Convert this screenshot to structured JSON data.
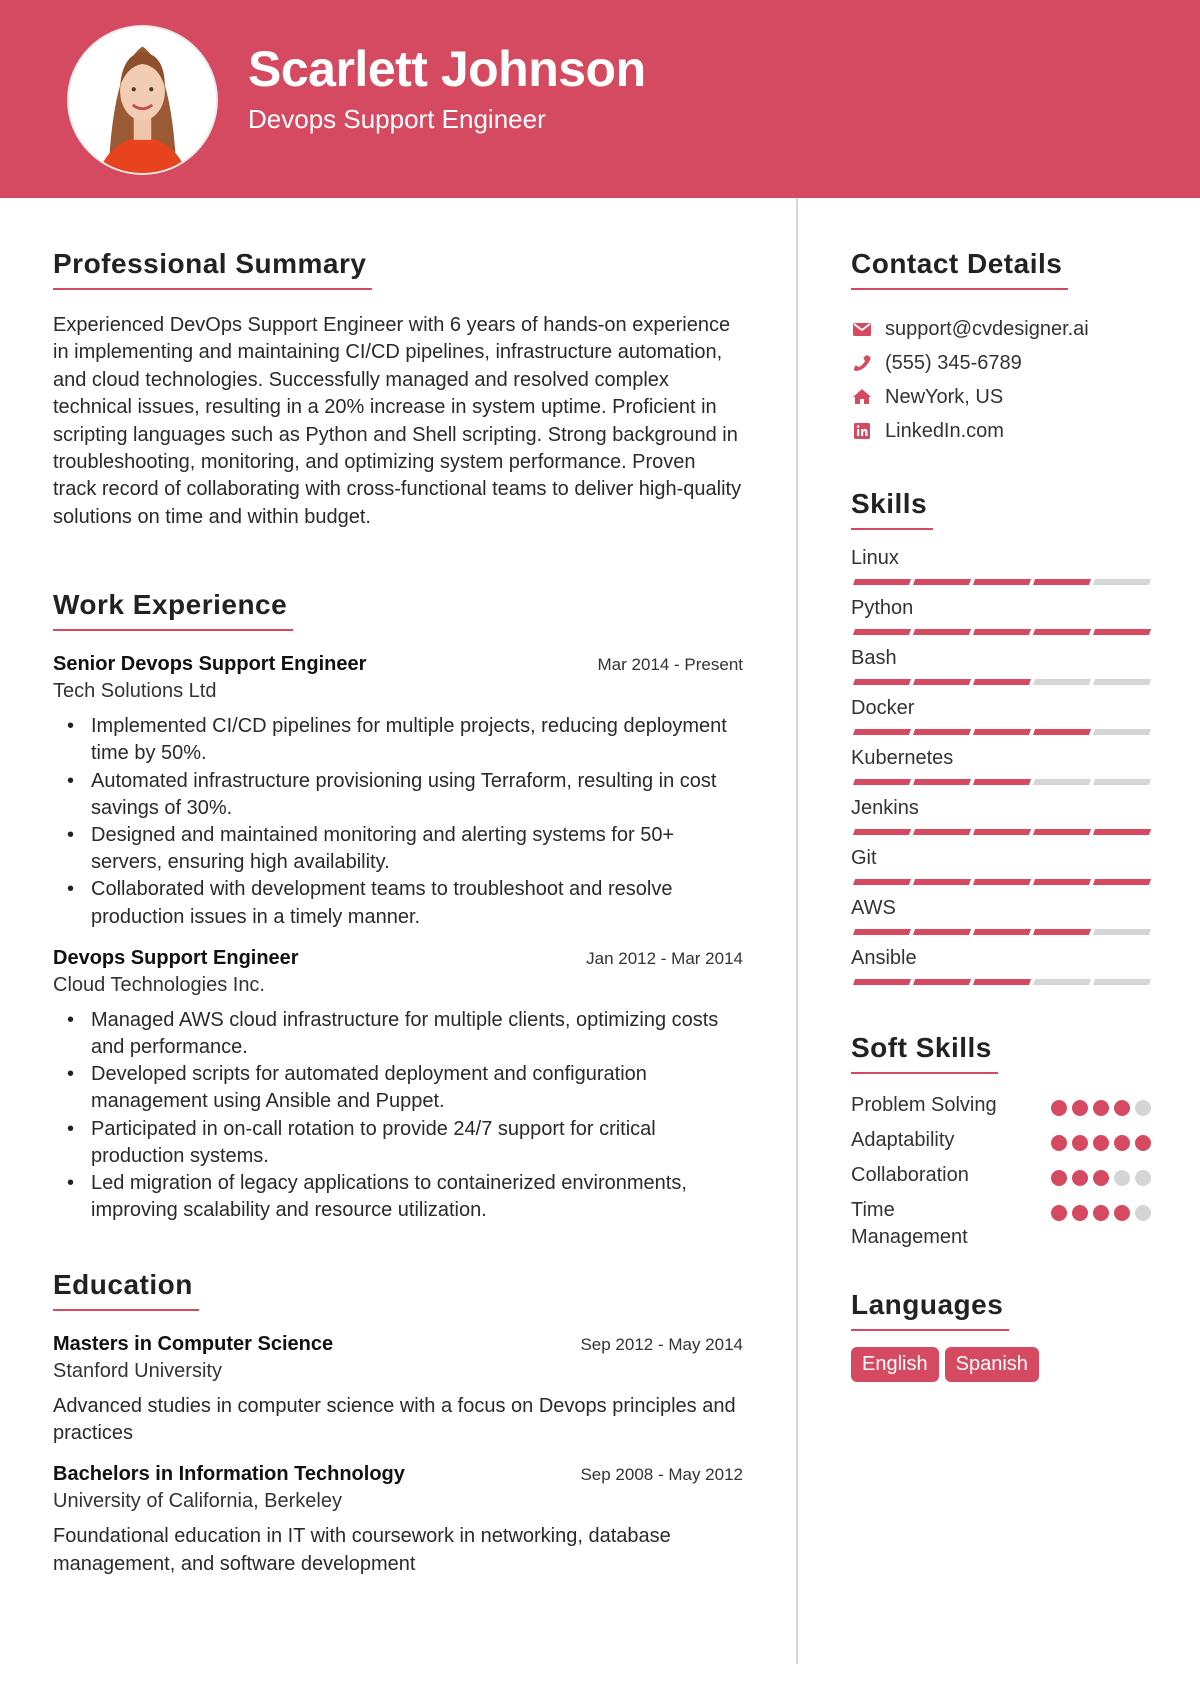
{
  "header": {
    "name": "Scarlett Johnson",
    "role": "Devops Support Engineer",
    "accent_color": "#D64A61"
  },
  "summary": {
    "title": "Professional Summary",
    "text": "Experienced DevOps Support Engineer with 6 years of hands-on experience in implementing and maintaining CI/CD pipelines, infrastructure automation, and cloud technologies. Successfully managed and resolved complex technical issues, resulting in a 20% increase in system uptime. Proficient in scripting languages such as Python and Shell scripting. Strong background in troubleshooting, monitoring, and optimizing system performance. Proven track record of collaborating with cross-functional teams to deliver high-quality solutions on time and within budget."
  },
  "experience": {
    "title": "Work Experience",
    "jobs": [
      {
        "title": "Senior Devops Support Engineer",
        "dates": "Mar 2014 - Present",
        "company": "Tech Solutions Ltd",
        "bullets": [
          "Implemented CI/CD pipelines for multiple projects, reducing deployment time by 50%.",
          "Automated infrastructure provisioning using Terraform, resulting in cost savings of 30%.",
          "Designed and maintained monitoring and alerting systems for 50+ servers, ensuring high availability.",
          "Collaborated with development teams to troubleshoot and resolve production issues in a timely manner."
        ]
      },
      {
        "title": "Devops Support Engineer",
        "dates": "Jan 2012 - Mar 2014",
        "company": "Cloud Technologies Inc.",
        "bullets": [
          "Managed AWS cloud infrastructure for multiple clients, optimizing costs and performance.",
          "Developed scripts for automated deployment and configuration management using Ansible and Puppet.",
          "Participated in on-call rotation to provide 24/7 support for critical production systems.",
          "Led migration of legacy applications to containerized environments, improving scalability and resource utilization."
        ]
      }
    ]
  },
  "education": {
    "title": "Education",
    "items": [
      {
        "degree": "Masters in Computer Science",
        "dates": "Sep 2012 - May 2014",
        "school": "Stanford University",
        "description": "Advanced studies in computer science with a focus on Devops principles and practices"
      },
      {
        "degree": "Bachelors in Information Technology",
        "dates": "Sep 2008 - May 2012",
        "school": "University of California, Berkeley",
        "description": "Foundational education in IT with coursework in networking, database management, and software development"
      }
    ]
  },
  "contact": {
    "title": "Contact Details",
    "items": [
      {
        "icon": "envelope-icon",
        "text": "support@cvdesigner.ai"
      },
      {
        "icon": "phone-icon",
        "text": "(555) 345-6789"
      },
      {
        "icon": "home-icon",
        "text": "NewYork, US"
      },
      {
        "icon": "linkedin-icon",
        "text": "LinkedIn.com"
      }
    ]
  },
  "skills": {
    "title": "Skills",
    "max": 5,
    "items": [
      {
        "name": "Linux",
        "level": 4
      },
      {
        "name": "Python",
        "level": 5
      },
      {
        "name": "Bash",
        "level": 3
      },
      {
        "name": "Docker",
        "level": 4
      },
      {
        "name": "Kubernetes",
        "level": 3
      },
      {
        "name": "Jenkins",
        "level": 5
      },
      {
        "name": "Git",
        "level": 5
      },
      {
        "name": "AWS",
        "level": 4
      },
      {
        "name": "Ansible",
        "level": 3
      }
    ]
  },
  "soft_skills": {
    "title": "Soft Skills",
    "max": 5,
    "items": [
      {
        "name": "Problem Solving",
        "level": 4
      },
      {
        "name": "Adaptability",
        "level": 5
      },
      {
        "name": "Collaboration",
        "level": 3
      },
      {
        "name": "Time Management",
        "level": 4
      }
    ]
  },
  "languages": {
    "title": "Languages",
    "items": [
      "English",
      "Spanish"
    ]
  }
}
